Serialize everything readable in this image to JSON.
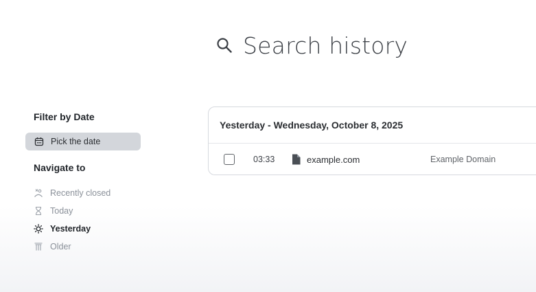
{
  "search": {
    "placeholder": "Search history",
    "icon": "search-icon"
  },
  "sidebar": {
    "filter_title": "Filter by Date",
    "pick_date_label": "Pick the date",
    "pick_date_icon": "calendar-icon",
    "navigate_title": "Navigate to",
    "nav_items": [
      {
        "label": "Recently closed",
        "icon": "recently-closed-icon",
        "active": false
      },
      {
        "label": "Today",
        "icon": "hourglass-icon",
        "active": false
      },
      {
        "label": "Yesterday",
        "icon": "sun-icon",
        "active": true
      },
      {
        "label": "Older",
        "icon": "column-icon",
        "active": false
      }
    ]
  },
  "history": {
    "group_header": "Yesterday - Wednesday, October 8, 2025",
    "entries": [
      {
        "time": "03:33",
        "icon": "file-icon",
        "domain": "example.com",
        "title": "Example Domain",
        "checked": false
      }
    ]
  },
  "colors": {
    "active_pill_bg": "#d3d6db",
    "muted_text": "#8a9099",
    "card_border": "#d6d9de"
  }
}
